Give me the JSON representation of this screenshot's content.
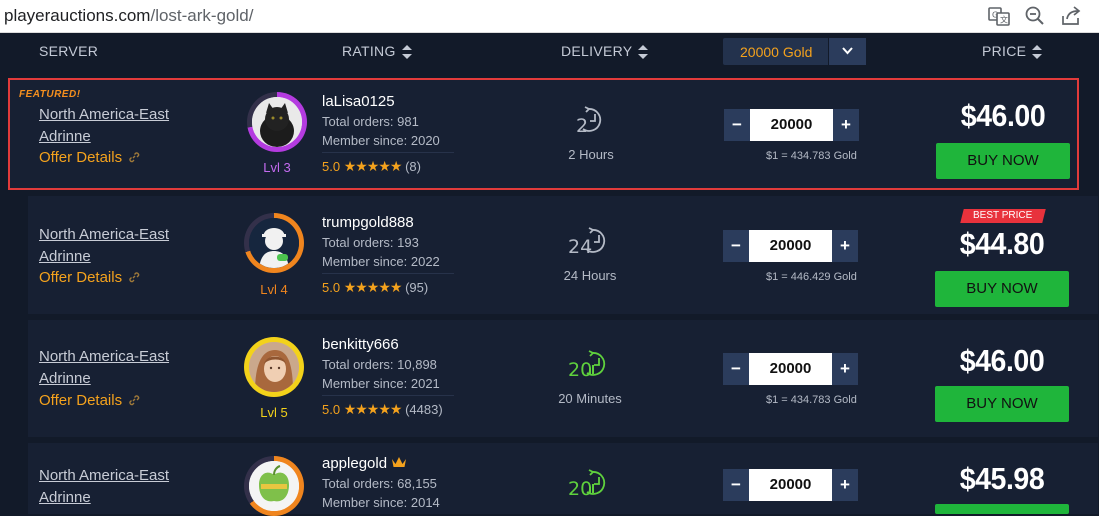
{
  "browser": {
    "url_domain": "playerauctions.com",
    "url_path": "/lost-ark-gold/",
    "icons": [
      "translate-icon",
      "zoom-out-icon",
      "share-icon"
    ]
  },
  "headers": {
    "server": "SERVER",
    "rating": "RATING",
    "delivery": "DELIVERY",
    "amount": "20000 Gold",
    "price": "PRICE"
  },
  "offers": [
    {
      "featured_label": "FEATURED!",
      "server": "North America-East",
      "realm": "Adrinne",
      "offer_details": "Offer Details",
      "seller": "laLisa0125",
      "total_orders": "Total orders: 981",
      "member_since": "Member since: 2020",
      "score": "5.0",
      "stars": "★★★★★",
      "reviews": "(8)",
      "level": "Lvl 3",
      "delivery_number": "2",
      "delivery_text": "2 Hours",
      "quantity": "20000",
      "rate": "$1 = 434.783 Gold",
      "price": "$46.00",
      "buy": "BUY NOW"
    },
    {
      "best_price": "BEST PRICE",
      "server": "North America-East",
      "realm": "Adrinne",
      "offer_details": "Offer Details",
      "seller": "trumpgold888",
      "total_orders": "Total orders: 193",
      "member_since": "Member since: 2022",
      "score": "5.0",
      "stars": "★★★★★",
      "reviews": "(95)",
      "level": "Lvl 4",
      "delivery_number": "24",
      "delivery_text": "24 Hours",
      "quantity": "20000",
      "rate": "$1 = 446.429 Gold",
      "price": "$44.80",
      "buy": "BUY NOW"
    },
    {
      "server": "North America-East",
      "realm": "Adrinne",
      "offer_details": "Offer Details",
      "seller": "benkitty666",
      "total_orders": "Total orders: 10,898",
      "member_since": "Member since: 2021",
      "score": "5.0",
      "stars": "★★★★★",
      "reviews": "(4483)",
      "level": "Lvl 5",
      "delivery_number": "20",
      "delivery_text": "20 Minutes",
      "quantity": "20000",
      "rate": "$1 = 434.783 Gold",
      "price": "$46.00",
      "buy": "BUY NOW"
    },
    {
      "server": "North America-East",
      "realm": "Adrinne",
      "seller": "applegold",
      "total_orders": "Total orders: 68,155",
      "member_since": "Member since: 2014",
      "delivery_number": "20",
      "quantity": "20000",
      "price": "$45.98"
    }
  ],
  "colors": {
    "accent_orange": "#f4a21d",
    "buy_green": "#1fb53b",
    "featured_border": "#e23b3b",
    "background": "#121a29"
  }
}
